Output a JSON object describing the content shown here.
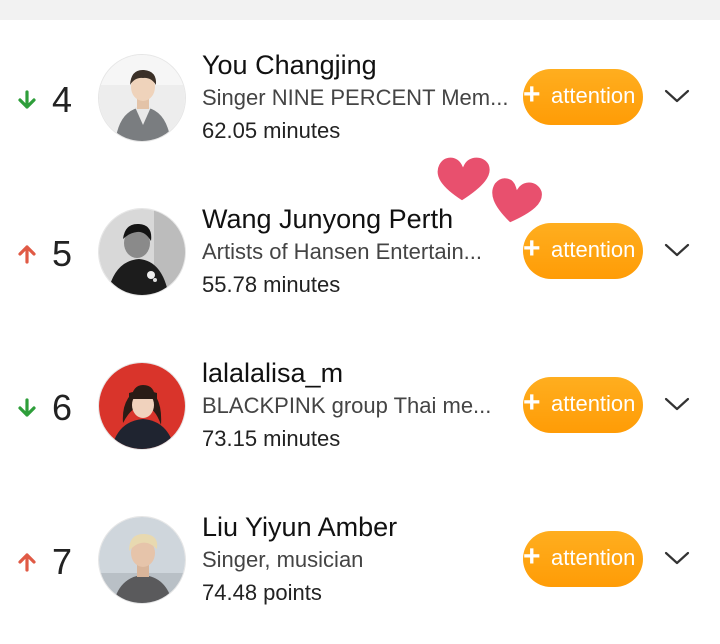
{
  "colors": {
    "accent": "#ff9c06",
    "trend_down": "#2e9e3a",
    "trend_up": "#e05a45",
    "heart": "#e8506e"
  },
  "icons": {
    "down": "arrow-down-icon",
    "up": "arrow-up-icon",
    "expand": "chevron-down-icon",
    "decoration": "heart-icon"
  },
  "rankings": [
    {
      "trend": "down",
      "rank": "4",
      "name": "You Changjing",
      "description": "Singer NINE PERCENT Mem...",
      "stat": "62.05 minutes",
      "follow_plus": "+",
      "follow_label": "attention"
    },
    {
      "trend": "up",
      "rank": "5",
      "name": "Wang Junyong Perth",
      "description": "Artists of Hansen Entertain...",
      "stat": "55.78 minutes",
      "follow_plus": "+",
      "follow_label": "attention"
    },
    {
      "trend": "down",
      "rank": "6",
      "name": "lalalalisa_m",
      "description": "BLACKPINK group Thai me...",
      "stat": "73.15 minutes",
      "follow_plus": "+",
      "follow_label": "attention"
    },
    {
      "trend": "up",
      "rank": "7",
      "name": "Liu Yiyun Amber",
      "description": "Singer, musician",
      "stat": "74.48 points",
      "follow_plus": "+",
      "follow_label": "attention"
    }
  ]
}
